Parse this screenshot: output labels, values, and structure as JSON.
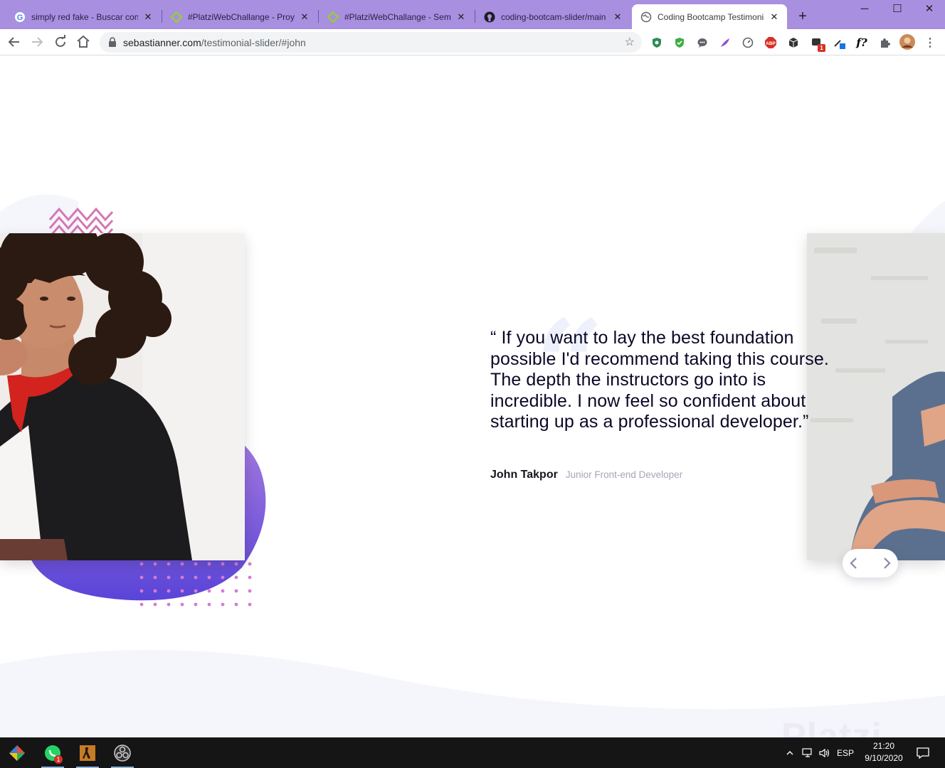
{
  "browser": {
    "tabs": [
      {
        "title": "simply red fake - Buscar con Google",
        "icon": "google-icon",
        "active": false
      },
      {
        "title": "#PlatziWebChallange - Proyecto",
        "icon": "platzi-icon",
        "active": false
      },
      {
        "title": "#PlatziWebChallange - Semana",
        "icon": "platzi-icon",
        "active": false
      },
      {
        "title": "coding-bootcam-slider/main",
        "icon": "github-icon",
        "active": false
      },
      {
        "title": "Coding Bootcamp Testimonial Slider",
        "icon": "globe-icon",
        "active": true
      }
    ],
    "new_tab_label": "+",
    "url_domain": "sebastianner.com",
    "url_path": "/testimonial-slider/#john",
    "extensions": [
      {
        "name": "adguard-extension-icon",
        "color": "#2e8b57"
      },
      {
        "name": "shield-extension-icon",
        "color": "#3cb043"
      },
      {
        "name": "chat-extension-icon",
        "color": "#5f6368"
      },
      {
        "name": "feather-extension-icon",
        "color": "#8a4fd8"
      },
      {
        "name": "gauge-extension-icon",
        "color": "#5f6368"
      },
      {
        "name": "adblock-plus-extension-icon",
        "label": "ABP",
        "color": "#d93025"
      },
      {
        "name": "box-extension-icon",
        "color": "#333333"
      },
      {
        "name": "notification-extension-icon",
        "badge": "1",
        "color": "#333333"
      },
      {
        "name": "picker-extension-icon",
        "color": "#1a73e8"
      },
      {
        "name": "font-extension-icon",
        "label": "f?",
        "color": "#202124"
      },
      {
        "name": "puzzle-extensions-icon",
        "color": "#5f6368"
      }
    ]
  },
  "testimonial": {
    "quote": "“ If you want to lay the best foundation possible I'd recommend taking this course. The depth the instructors go into is incredible. I now feel so confident about starting up as a professional developer.”",
    "author_name": "John Takpor",
    "author_role": "Junior Front-end Developer"
  },
  "watermark": "Platzi",
  "colors": {
    "accent_purple": "#6b4de6",
    "blob_gradient_top": "#a97ee0",
    "blob_gradient_bottom": "#5a44d8",
    "zigzag_pink": "#d478b5",
    "dots_pink": "#d77bd3",
    "bg_wave": "#f5f5fc"
  },
  "taskbar": {
    "apps": [
      "windows-start-icon",
      "whatsapp-icon",
      "game-app-icon",
      "obs-studio-icon"
    ],
    "whatsapp_badge": "1",
    "language": "ESP",
    "time": "21:20",
    "date": "9/10/2020"
  }
}
